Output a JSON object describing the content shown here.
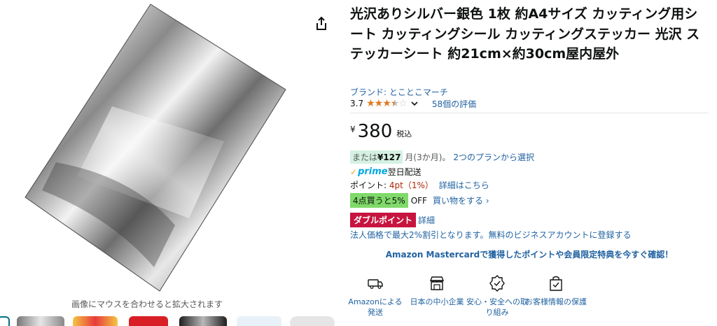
{
  "image": {
    "zoom_hint": "画像にマウスを合わせると拡大されます"
  },
  "product": {
    "title": "光沢ありシルバー銀色 1枚 約A4サイズ カッティング用シート カッティングシール カッティングステッカー 光沢 ステッカーシート 約21cm×約30cm屋内屋外",
    "brand": "ブランド: とことこマーチ",
    "rating": "3.7",
    "rating_value": 3.7,
    "stars_icon": "star-rating-icon",
    "reviews": "58個の評価"
  },
  "price": {
    "symbol": "¥",
    "value": "380",
    "tax": "税込"
  },
  "installment": {
    "prefix": "または",
    "amount": "¥127",
    "term": "月(3か月)。",
    "link": "2つのプランから選択"
  },
  "shipping": {
    "prime_check": "✓",
    "prime_label": "prime",
    "delivery": "翌日配送"
  },
  "points": {
    "label": "ポイント: ",
    "value": "4pt（1%）",
    "link": "詳細はこちら"
  },
  "bulk": {
    "badge": "4点買うと5%",
    "off": "OFF",
    "link": "買い物をする ›"
  },
  "double_point": {
    "badge": "ダブルポイント",
    "link": "詳細"
  },
  "business": {
    "text": "法人価格で最大2%割引となります。無料のビジネスアカウントに登録する"
  },
  "mastercard": {
    "text": "Amazon Mastercardで獲得したポイントや会員限定特典を今すぐ確認！"
  },
  "features": [
    {
      "icon": "delivery-truck-icon",
      "label": "Amazonによる発送"
    },
    {
      "icon": "storefront-icon",
      "label": "日本の中小企業"
    },
    {
      "icon": "shield-badge-icon",
      "label": "安心・安全への取り組み"
    },
    {
      "icon": "protected-bag-icon",
      "label": "お客様情報の保護"
    }
  ],
  "colors": {
    "link": "#2162a1",
    "star": "#de7921",
    "price_red": "#b12704",
    "installment_bg": "#d5f1e3",
    "bulk_bg": "#7fda69",
    "double_bg": "#c7143f",
    "prime": "#00a8e1"
  }
}
